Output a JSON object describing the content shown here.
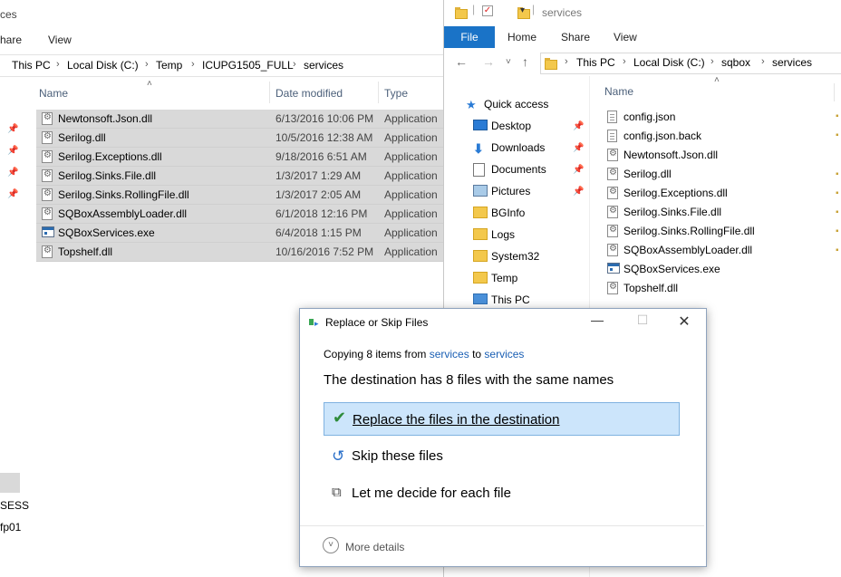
{
  "left_window": {
    "title": "ces",
    "ribbon": [
      "hare",
      "View"
    ],
    "breadcrumb": [
      "This PC",
      "Local Disk (C:)",
      "Temp",
      "ICUPG1505_FULL",
      "services"
    ],
    "columns": {
      "name": "Name",
      "date": "Date modified",
      "type": "Type"
    },
    "files": [
      {
        "name": "Newtonsoft.Json.dll",
        "date": "6/13/2016 10:06 PM",
        "type": "Application",
        "icon": "gear-icon"
      },
      {
        "name": "Serilog.dll",
        "date": "10/5/2016 12:38 AM",
        "type": "Application",
        "icon": "gear-icon"
      },
      {
        "name": "Serilog.Exceptions.dll",
        "date": "9/18/2016 6:51 AM",
        "type": "Application",
        "icon": "gear-icon"
      },
      {
        "name": "Serilog.Sinks.File.dll",
        "date": "1/3/2017 1:29 AM",
        "type": "Application",
        "icon": "gear-icon"
      },
      {
        "name": "Serilog.Sinks.RollingFile.dll",
        "date": "1/3/2017 2:05 AM",
        "type": "Application",
        "icon": "gear-icon"
      },
      {
        "name": "SQBoxAssemblyLoader.dll",
        "date": "6/1/2018 12:16 PM",
        "type": "Application",
        "icon": "gear-icon"
      },
      {
        "name": "SQBoxServices.exe",
        "date": "6/4/2018 1:15 PM",
        "type": "Application",
        "icon": "exe-icon"
      },
      {
        "name": "Topshelf.dll",
        "date": "10/16/2016 7:52 PM",
        "type": "Application",
        "icon": "gear-icon"
      }
    ],
    "side_fragments": [
      "SESS",
      "fp01"
    ]
  },
  "right_window": {
    "title": "services",
    "tabs": [
      "File",
      "Home",
      "Share",
      "View"
    ],
    "breadcrumb": [
      "This PC",
      "Local Disk (C:)",
      "sqbox",
      "services"
    ],
    "nav": [
      {
        "label": "Quick access",
        "icon": "star-icon",
        "pinned": false
      },
      {
        "label": "Desktop",
        "icon": "desktop-icon",
        "pinned": true
      },
      {
        "label": "Downloads",
        "icon": "download-icon",
        "pinned": true
      },
      {
        "label": "Documents",
        "icon": "documents-icon",
        "pinned": true
      },
      {
        "label": "Pictures",
        "icon": "pictures-icon",
        "pinned": true
      },
      {
        "label": "BGInfo",
        "icon": "folder-icon",
        "pinned": false
      },
      {
        "label": "Logs",
        "icon": "folder-icon",
        "pinned": false
      },
      {
        "label": "System32",
        "icon": "folder-icon",
        "pinned": false
      },
      {
        "label": "Temp",
        "icon": "folder-icon",
        "pinned": false
      },
      {
        "label": "This PC",
        "icon": "pc-icon",
        "pinned": false
      }
    ],
    "column_name": "Name",
    "files": [
      {
        "name": "config.json",
        "icon": "doc-icon"
      },
      {
        "name": "config.json.back",
        "icon": "doc-icon"
      },
      {
        "name": "Newtonsoft.Json.dll",
        "icon": "gear-icon"
      },
      {
        "name": "Serilog.dll",
        "icon": "gear-icon"
      },
      {
        "name": "Serilog.Exceptions.dll",
        "icon": "gear-icon"
      },
      {
        "name": "Serilog.Sinks.File.dll",
        "icon": "gear-icon"
      },
      {
        "name": "Serilog.Sinks.RollingFile.dll",
        "icon": "gear-icon"
      },
      {
        "name": "SQBoxAssemblyLoader.dll",
        "icon": "gear-icon"
      },
      {
        "name": "SQBoxServices.exe",
        "icon": "exe-icon"
      },
      {
        "name": "Topshelf.dll",
        "icon": "gear-icon"
      }
    ]
  },
  "dialog": {
    "title": "Replace or Skip Files",
    "copy_prefix": "Copying 8 items from ",
    "copy_from": "services",
    "copy_mid": " to ",
    "copy_to": "services",
    "heading": "The destination has 8 files with the same names",
    "options": [
      {
        "label": "Replace the files in the destination",
        "icon": "check-icon"
      },
      {
        "label": "Skip these files",
        "icon": "skip-icon"
      },
      {
        "label": "Let me decide for each file",
        "icon": "decide-icon"
      }
    ],
    "more_details": "More details",
    "colors": {
      "accent": "#1a73c7",
      "selection": "#cce5fb",
      "link": "#1a5fb4"
    }
  }
}
